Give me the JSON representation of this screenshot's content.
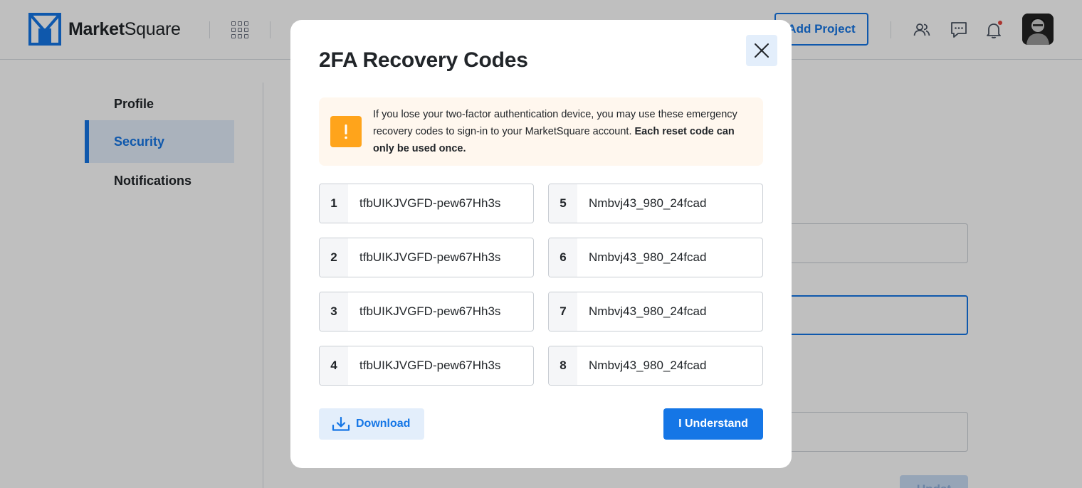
{
  "header": {
    "brand_bold": "Market",
    "brand_regular": "Square",
    "add_project_label": "Add Project"
  },
  "sidebar": {
    "items": [
      {
        "label": "Profile",
        "active": false
      },
      {
        "label": "Security",
        "active": true
      },
      {
        "label": "Notifications",
        "active": false
      }
    ]
  },
  "background": {
    "partial_button_label": "Updat"
  },
  "modal": {
    "title": "2FA Recovery Codes",
    "alert_text": "If you lose your two-factor authentication device, you may use these emergency recovery codes to sign-in to your MarketSquare account.",
    "alert_bold": "Each reset code can only be used once.",
    "codes": [
      {
        "num": "1",
        "value": "tfbUIKJVGFD-pew67Hh3s"
      },
      {
        "num": "2",
        "value": "tfbUIKJVGFD-pew67Hh3s"
      },
      {
        "num": "3",
        "value": "tfbUIKJVGFD-pew67Hh3s"
      },
      {
        "num": "4",
        "value": "tfbUIKJVGFD-pew67Hh3s"
      },
      {
        "num": "5",
        "value": "Nmbvj43_980_24fcad"
      },
      {
        "num": "6",
        "value": "Nmbvj43_980_24fcad"
      },
      {
        "num": "7",
        "value": "Nmbvj43_980_24fcad"
      },
      {
        "num": "8",
        "value": "Nmbvj43_980_24fcad"
      }
    ],
    "download_label": "Download",
    "understand_label": "I Understand"
  },
  "colors": {
    "accent": "#1576e6",
    "warning": "#ffa41b",
    "alert_bg": "#fff7ee",
    "active_bg": "#e3eefb"
  },
  "icons": [
    "logo-mark-icon",
    "apps-grid-icon",
    "users-icon",
    "chat-icon",
    "bell-icon",
    "close-icon",
    "exclamation-icon",
    "download-icon"
  ]
}
